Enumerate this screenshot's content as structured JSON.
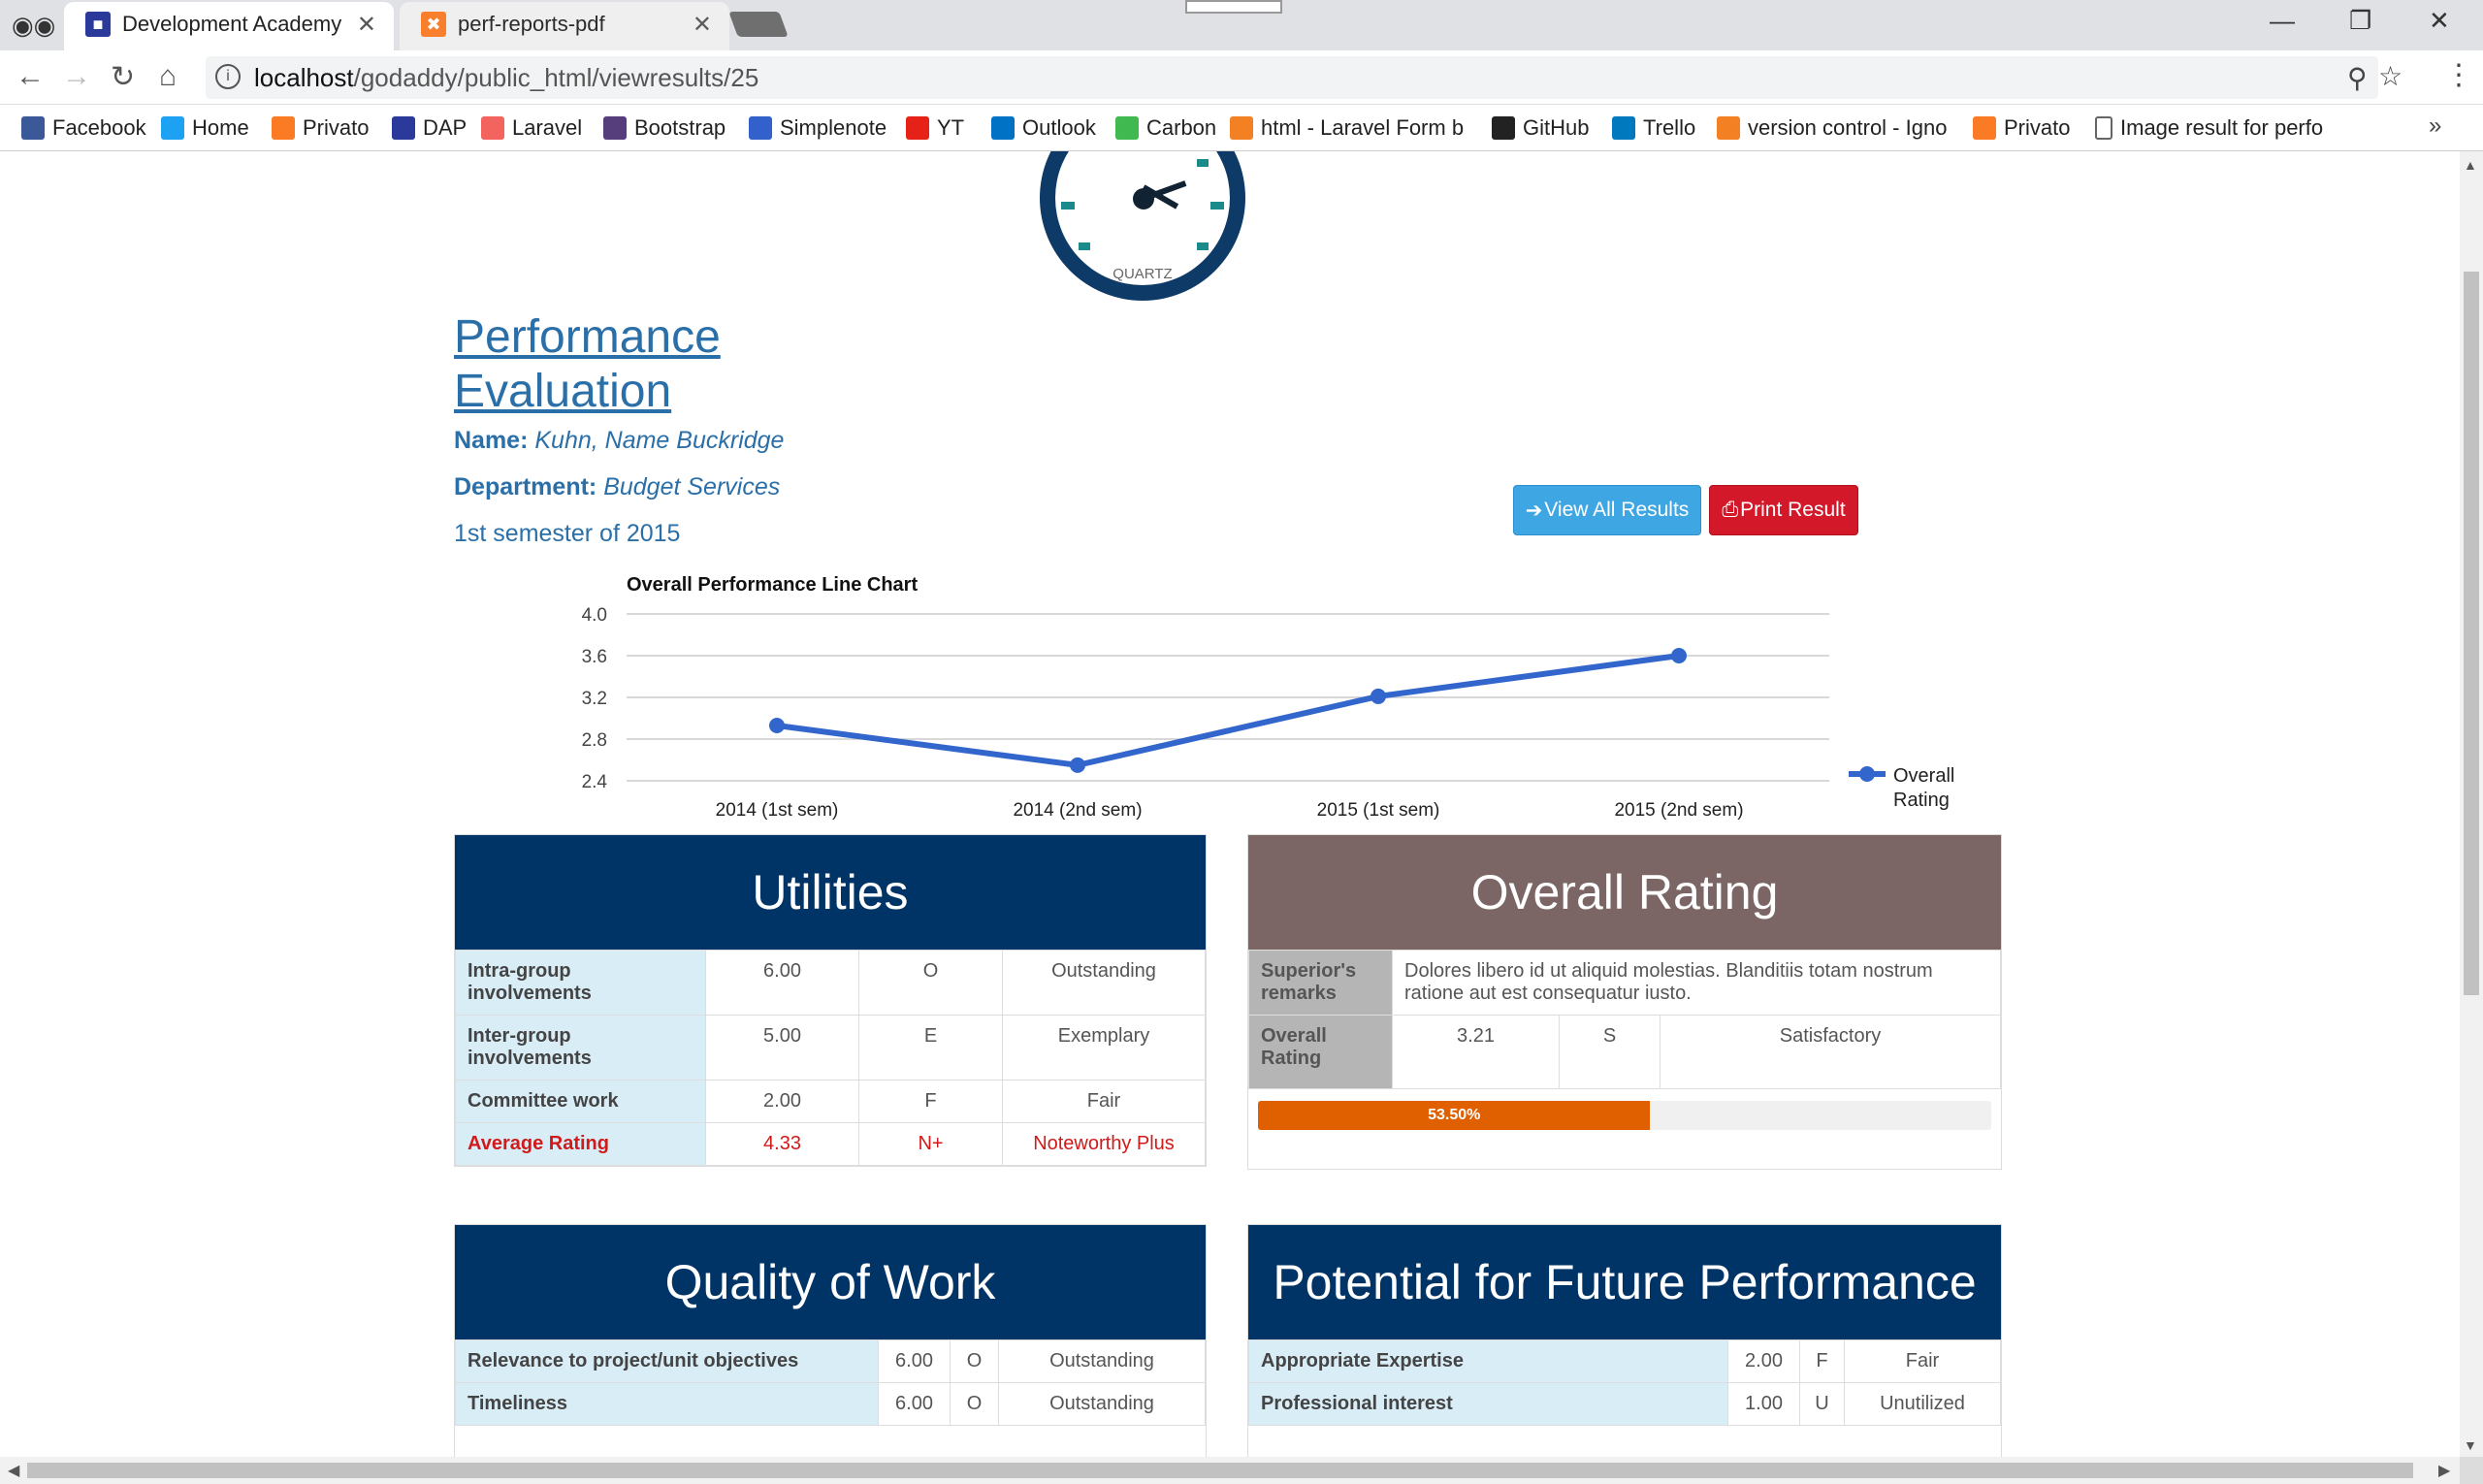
{
  "browser": {
    "tabs": [
      {
        "title": "Development Academy c",
        "active": true
      },
      {
        "title": "perf-reports-pdf",
        "active": false
      }
    ],
    "url_host": "localhost",
    "url_path": "/godaddy/public_html/viewresults/25",
    "bookmarks": [
      {
        "label": "Facebook",
        "icon": "facebook-icon",
        "color": "#3b5998"
      },
      {
        "label": "Home",
        "icon": "twitter-icon",
        "color": "#1da1f2"
      },
      {
        "label": "Privato",
        "icon": "xampp-icon",
        "color": "#fb7a24"
      },
      {
        "label": "DAP",
        "icon": "dap-icon",
        "color": "#2b3a9a"
      },
      {
        "label": "Laravel",
        "icon": "laravel-icon",
        "color": "#f4645f"
      },
      {
        "label": "Bootstrap",
        "icon": "bootstrap-icon",
        "color": "#563d7c"
      },
      {
        "label": "Simplenote",
        "icon": "simplenote-icon",
        "color": "#3361cc"
      },
      {
        "label": "YT",
        "icon": "youtube-icon",
        "color": "#e62117"
      },
      {
        "label": "Outlook",
        "icon": "outlook-icon",
        "color": "#0072c6"
      },
      {
        "label": "Carbon",
        "icon": "carbon-icon",
        "color": "#3fb950"
      },
      {
        "label": "html - Laravel Form b",
        "icon": "stackoverflow-icon",
        "color": "#f48024"
      },
      {
        "label": "GitHub",
        "icon": "github-icon",
        "color": "#222222"
      },
      {
        "label": "Trello",
        "icon": "trello-icon",
        "color": "#0079bf"
      },
      {
        "label": "version control - Igno",
        "icon": "stackoverflow-icon",
        "color": "#f48024"
      },
      {
        "label": "Privato",
        "icon": "xampp-icon",
        "color": "#fb7a24"
      },
      {
        "label": "Image result for perfo",
        "icon": "page-icon",
        "color": "#ffffff"
      }
    ]
  },
  "logo": {
    "text": "QUARTZ"
  },
  "page": {
    "title": "Performance Evaluation",
    "name_label": "Name:",
    "name_value": "Kuhn, Name Buckridge",
    "dept_label": "Department:",
    "dept_value": "Budget Services",
    "semester": "1st semester of 2015",
    "view_all_label": "View All Results",
    "print_label": "Print Result"
  },
  "chart_data": {
    "type": "line",
    "title": "Overall Performance Line Chart",
    "categories": [
      "2014 (1st sem)",
      "2014 (2nd sem)",
      "2015 (1st sem)",
      "2015 (2nd sem)"
    ],
    "series": [
      {
        "name": "Overall Rating",
        "values": [
          2.93,
          2.55,
          3.21,
          3.6
        ],
        "color": "#3366cc"
      }
    ],
    "ylim": [
      2.4,
      4.0
    ],
    "yticks": [
      "4.0",
      "3.6",
      "3.2",
      "2.8",
      "2.4"
    ],
    "legend_position": "right",
    "grid": true
  },
  "utilities": {
    "title": "Utilities",
    "rows": [
      {
        "label": "Intra-group involvements",
        "score": "6.00",
        "code": "O",
        "desc": "Outstanding"
      },
      {
        "label": "Inter-group involvements",
        "score": "5.00",
        "code": "E",
        "desc": "Exemplary"
      },
      {
        "label": "Committee work",
        "score": "2.00",
        "code": "F",
        "desc": "Fair"
      },
      {
        "label": "Average Rating",
        "score": "4.33",
        "code": "N+",
        "desc": "Noteworthy Plus"
      }
    ]
  },
  "overall": {
    "title": "Overall Rating",
    "remarks_label": "Superior's remarks",
    "remarks": "Dolores libero id ut aliquid molestias. Blanditiis totam nostrum ratione aut est consequatur iusto.",
    "rating_label": "Overall Rating",
    "rating_score": "3.21",
    "rating_code": "S",
    "rating_desc": "Satisfactory",
    "progress_label": "53.50%",
    "progress_value": 53.5,
    "progress_color": "#e06000"
  },
  "quality": {
    "title": "Quality of Work",
    "rows": [
      {
        "label": "Relevance to project/unit objectives",
        "score": "6.00",
        "code": "O",
        "desc": "Outstanding"
      },
      {
        "label": "Timeliness",
        "score": "6.00",
        "code": "O",
        "desc": "Outstanding"
      }
    ]
  },
  "potential": {
    "title": "Potential for Future Performance",
    "rows": [
      {
        "label": "Appropriate Expertise",
        "score": "2.00",
        "code": "F",
        "desc": "Fair"
      },
      {
        "label": "Professional interest",
        "score": "1.00",
        "code": "U",
        "desc": "Unutilized"
      }
    ]
  }
}
